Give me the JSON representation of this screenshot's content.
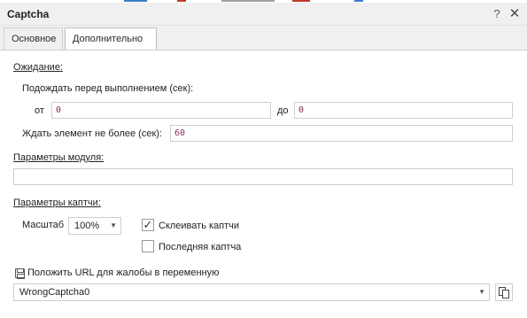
{
  "window": {
    "title": "Captcha",
    "help_glyph": "?",
    "close_glyph": "✕"
  },
  "tabs": [
    {
      "label": "Основное"
    },
    {
      "label": "Дополнительно"
    }
  ],
  "wait": {
    "section_title": "Ожидание:",
    "before_exec_label": "Подождать перед выполнением (сек):",
    "from_label": "от",
    "from_value": "0",
    "to_label": "до",
    "to_value": "0",
    "element_label": "Ждать элемент не более (сек):",
    "element_value": "60"
  },
  "module": {
    "section_title": "Параметры модуля:",
    "value": ""
  },
  "captcha": {
    "section_title": "Параметры каптчи:",
    "scale_label": "Масштаб",
    "scale_value": "100%",
    "glue_label": "Склеивать каптчи",
    "glue_checked": true,
    "last_label": "Последняя каптча",
    "last_checked": false,
    "check_glyph": "✓"
  },
  "url_var": {
    "label": "Положить URL для жалобы в переменную",
    "value": "WrongCaptcha0"
  },
  "icons": {
    "save": "save-icon",
    "copy": "copy-icon",
    "dropdown": "▼"
  }
}
